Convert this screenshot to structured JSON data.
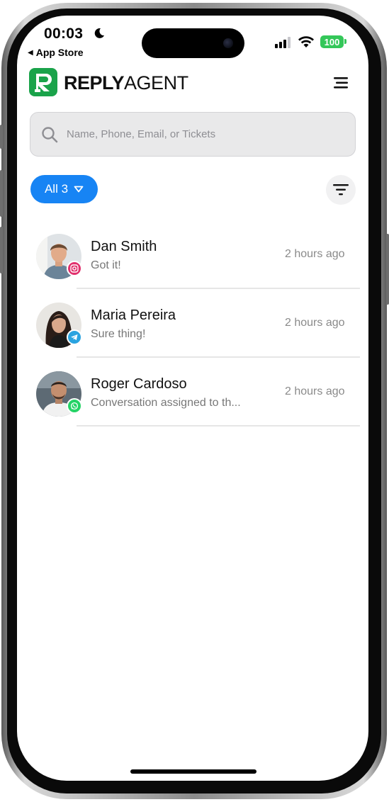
{
  "status_bar": {
    "time": "00:03",
    "back_app": "App Store",
    "battery": "100"
  },
  "header": {
    "brand_bold": "REPLY",
    "brand_light": "AGENT",
    "brand_color": "#1aa34a"
  },
  "search": {
    "placeholder": "Name, Phone, Email, or Tickets"
  },
  "filter": {
    "pill_label": "All 3",
    "accent_color": "#1784f4"
  },
  "conversations": [
    {
      "name": "Dan Smith",
      "message": "Got it!",
      "time": "2 hours ago",
      "channel": "instagram-icon"
    },
    {
      "name": "Maria Pereira",
      "message": "Sure thing!",
      "time": "2 hours ago",
      "channel": "telegram-icon"
    },
    {
      "name": "Roger Cardoso",
      "message": "Conversation assigned to th...",
      "time": "2 hours ago",
      "channel": "whatsapp-icon"
    }
  ]
}
